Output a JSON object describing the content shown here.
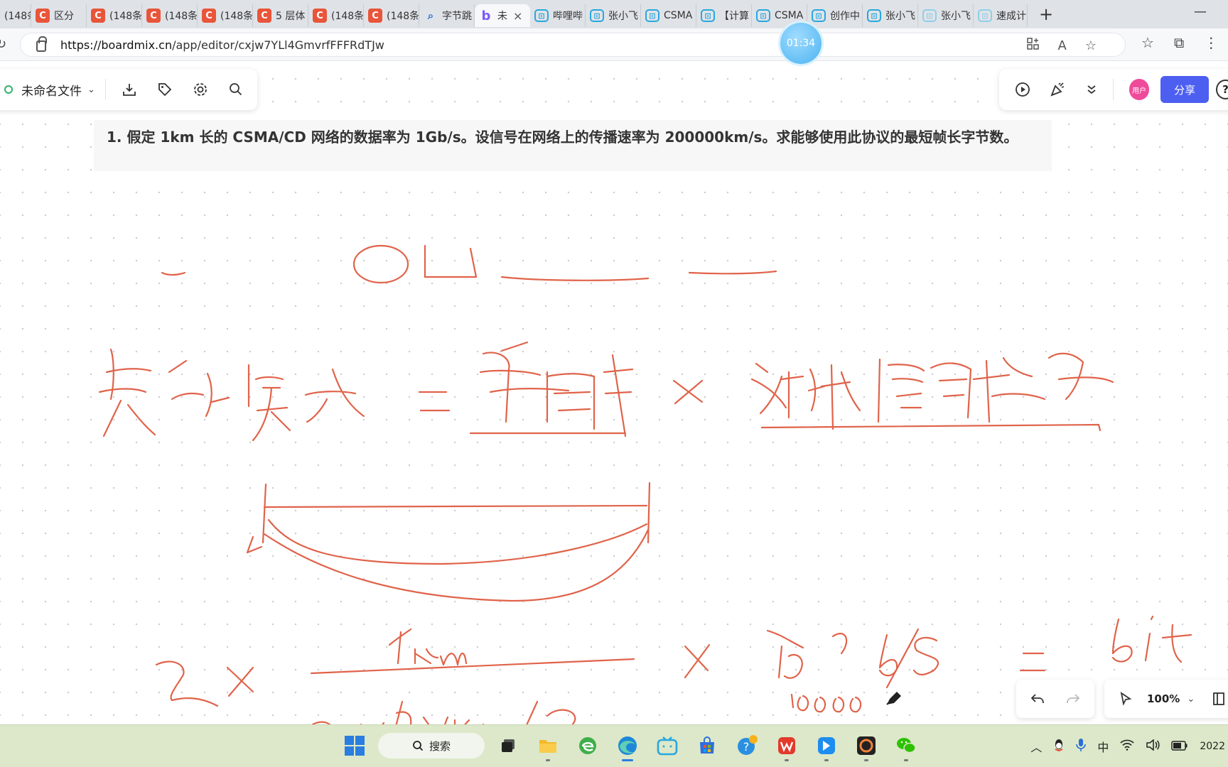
{
  "browser": {
    "tabs": [
      {
        "icon": "csdn-icon",
        "label": "(148条"
      },
      {
        "icon": "csdn-icon",
        "label": "区分"
      },
      {
        "icon": "csdn-icon",
        "label": "(148条"
      },
      {
        "icon": "csdn-icon",
        "label": "(148条"
      },
      {
        "icon": "csdn-icon",
        "label": "(148条"
      },
      {
        "icon": "csdn-icon",
        "label": "5 层体"
      },
      {
        "icon": "csdn-icon",
        "label": "(148条"
      },
      {
        "icon": "csdn-icon",
        "label": "(148条"
      },
      {
        "icon": "search-icon",
        "label": "字节跳"
      },
      {
        "icon": "boardmix-icon",
        "label": "未"
      },
      {
        "icon": "bilibili-icon",
        "label": "哔哩哔"
      },
      {
        "icon": "bilibili-icon",
        "label": "张小飞"
      },
      {
        "icon": "bilibili-icon",
        "label": "CSMA"
      },
      {
        "icon": "bilibili-icon",
        "label": "【计算"
      },
      {
        "icon": "bilibili-icon",
        "label": "CSMA"
      },
      {
        "icon": "bilibili-icon",
        "label": "创作中"
      },
      {
        "icon": "bilibili-icon",
        "label": "张小飞"
      },
      {
        "icon": "bilibili-icon",
        "label": "张小飞"
      },
      {
        "icon": "bilibili-icon",
        "label": "速成计"
      }
    ],
    "active_tab_close": "×",
    "new_tab": "+",
    "minimize": "—",
    "url_host": "https://boardmix.cn",
    "url_path": "/app/editor/cxjw7YLl4GmvrfFFFRdTJw",
    "timer": "01:34",
    "read_aloud": "A"
  },
  "editor": {
    "file_name": "未命名文件",
    "avatar_label": "用户",
    "share_label": "分享",
    "help_label": "?",
    "question_text": "1. 假定 1km 长的 CSMA/CD 网络的数据率为 1Gb/s。设信号在网络上的传播速率为 200000km/s。求能够使用此协议的最短帧长字节数。",
    "zoom": "100%"
  },
  "taskbar": {
    "search_label": "搜索",
    "ime": "中",
    "clock": "2022"
  },
  "colors": {
    "ink": "#e0634a",
    "share": "#4c5ff0",
    "taskbar": "#dce8c9"
  }
}
